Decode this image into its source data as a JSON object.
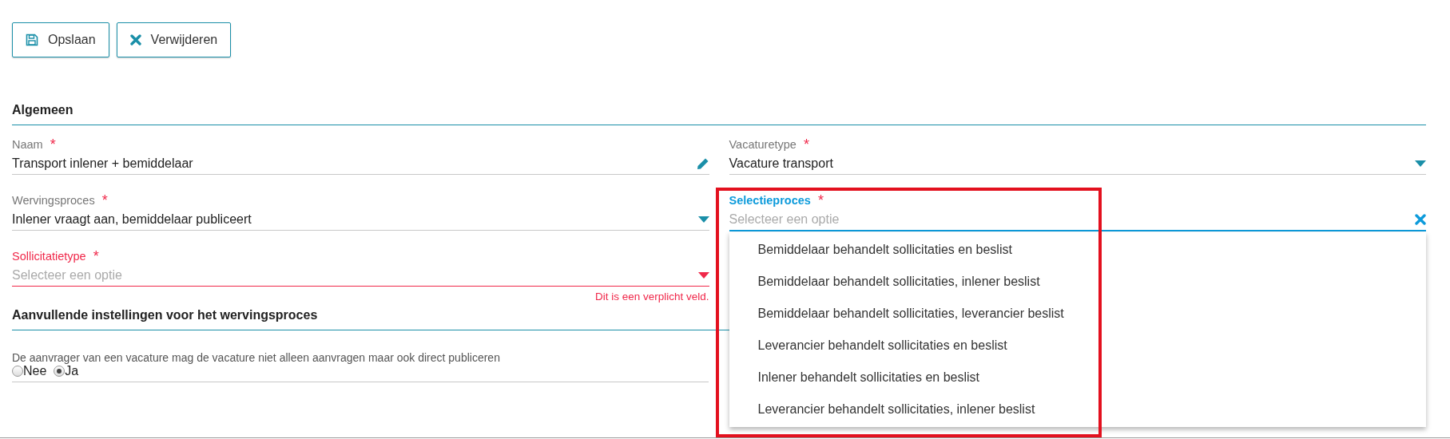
{
  "toolbar": [
    {
      "kind": "save",
      "label": "Opslaan"
    },
    {
      "kind": "delete",
      "label": "Verwijderen"
    }
  ],
  "general": {
    "heading": "Algemeen",
    "fields": [
      {
        "kind": "text",
        "label": "Naam",
        "required_mark": "*",
        "focused": false,
        "invalid": false,
        "value": "Transport inlener + bemiddelaar"
      },
      {
        "kind": "select",
        "label": "Vacaturetype",
        "required_mark": "*",
        "focused": false,
        "invalid": false,
        "value": "Vacature transport"
      },
      {
        "kind": "select",
        "label": "Wervingsproces",
        "required_mark": "*",
        "focused": false,
        "invalid": false,
        "value": "Inlener vraagt aan, bemiddelaar publiceert"
      },
      {
        "kind": "select",
        "label": "Selectieproces",
        "required_mark": "*",
        "focused": true,
        "invalid": false,
        "placeholder": "Selecteer een optie",
        "expanded": true,
        "highlighted": true,
        "options": [
          "Bemiddelaar behandelt sollicitaties en beslist",
          "Bemiddelaar behandelt sollicitaties, inlener beslist",
          "Bemiddelaar behandelt sollicitaties, leverancier beslist",
          "Leverancier behandelt sollicitaties en beslist",
          "Inlener behandelt sollicitaties en beslist",
          "Leverancier behandelt sollicitaties, inlener beslist"
        ]
      },
      {
        "kind": "select",
        "label": "Sollicitatietype",
        "required_mark": "*",
        "focused": false,
        "invalid": true,
        "placeholder": "Selecteer een optie",
        "error": "Dit is een verplicht veld."
      }
    ]
  },
  "additional": {
    "heading": "Aanvullende instellingen voor het wervingsproces",
    "question": "De aanvrager van een vacature mag de vacature niet alleen aanvragen maar ook direct publiceren",
    "options": [
      {
        "label": "Nee",
        "selected": false
      },
      {
        "label": "Ja",
        "selected": true
      }
    ]
  }
}
